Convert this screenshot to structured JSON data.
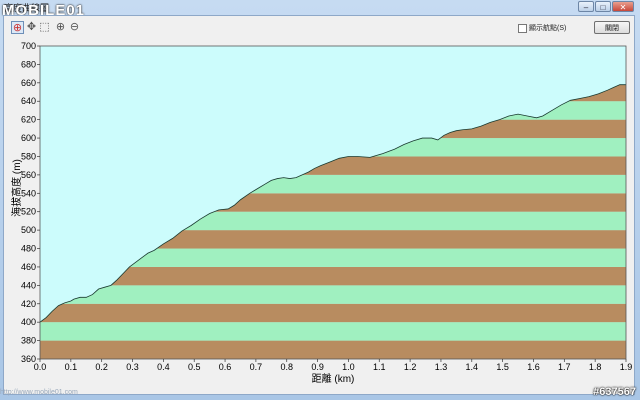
{
  "window": {
    "title": "高度曲線圖",
    "logo_text": "MOBILE01",
    "min_label": "–",
    "max_label": "□",
    "close_label": "✕"
  },
  "toolbar": {
    "tools": [
      {
        "name": "select-tool",
        "icon": "crosshair-icon",
        "glyph": "⊕"
      },
      {
        "name": "pan-tool",
        "icon": "move-icon",
        "glyph": "✥"
      },
      {
        "name": "zoom-box-tool",
        "icon": "zoom-box-icon",
        "glyph": "⬚"
      },
      {
        "name": "zoom-in-tool",
        "icon": "zoom-in-icon",
        "glyph": "⊕"
      },
      {
        "name": "zoom-out-tool",
        "icon": "zoom-out-icon",
        "glyph": "⊖"
      }
    ],
    "show_waypoints_label": "顯示航點(S)",
    "show_waypoints_checked": false,
    "close_button_label": "關閉"
  },
  "watermark": "http://www.mobile01.com",
  "id_tag": "#637567",
  "colors": {
    "sky": "#ccfcfc",
    "band_green": "#a0f0c0",
    "band_brown": "#b88c60",
    "outline": "#1a3a30"
  },
  "chart_data": {
    "type": "area",
    "title": "",
    "xlabel": "距離  (km)",
    "ylabel": "海拔高度  (m)",
    "xlim": [
      0.0,
      1.9
    ],
    "ylim": [
      360,
      700
    ],
    "x_ticks": [
      "0.0",
      "0.1",
      "0.2",
      "0.3",
      "0.4",
      "0.5",
      "0.6",
      "0.7",
      "0.8",
      "0.9",
      "1.0",
      "1.1",
      "1.2",
      "1.3",
      "1.4",
      "1.5",
      "1.6",
      "1.7",
      "1.8",
      "1.9"
    ],
    "y_ticks": [
      "360",
      "380",
      "400",
      "420",
      "440",
      "460",
      "480",
      "500",
      "520",
      "540",
      "560",
      "580",
      "600",
      "620",
      "640",
      "660",
      "680",
      "700"
    ],
    "grid": false,
    "legend": "none",
    "x": [
      0.0,
      0.02,
      0.04,
      0.06,
      0.08,
      0.1,
      0.11,
      0.13,
      0.15,
      0.17,
      0.19,
      0.21,
      0.23,
      0.25,
      0.27,
      0.29,
      0.31,
      0.33,
      0.35,
      0.37,
      0.4,
      0.43,
      0.46,
      0.49,
      0.52,
      0.55,
      0.58,
      0.61,
      0.63,
      0.65,
      0.68,
      0.71,
      0.73,
      0.75,
      0.77,
      0.79,
      0.81,
      0.83,
      0.85,
      0.87,
      0.89,
      0.91,
      0.94,
      0.97,
      1.0,
      1.03,
      1.07,
      1.11,
      1.15,
      1.18,
      1.21,
      1.24,
      1.27,
      1.29,
      1.31,
      1.33,
      1.35,
      1.37,
      1.4,
      1.43,
      1.46,
      1.49,
      1.52,
      1.55,
      1.58,
      1.61,
      1.63,
      1.66,
      1.69,
      1.72,
      1.75,
      1.78,
      1.81,
      1.84,
      1.86,
      1.88,
      1.9
    ],
    "y": [
      400,
      405,
      412,
      418,
      421,
      423,
      425,
      427,
      427,
      430,
      436,
      438,
      440,
      446,
      453,
      460,
      465,
      470,
      475,
      478,
      485,
      491,
      499,
      505,
      512,
      518,
      522,
      523,
      527,
      533,
      540,
      546,
      550,
      554,
      556,
      557,
      556,
      557,
      560,
      563,
      567,
      570,
      574,
      578,
      580,
      580,
      579,
      583,
      588,
      593,
      597,
      600,
      600,
      598,
      603,
      606,
      608,
      609,
      610,
      613,
      617,
      620,
      624,
      626,
      624,
      622,
      624,
      630,
      636,
      641,
      643,
      645,
      648,
      652,
      655,
      658,
      658
    ]
  }
}
